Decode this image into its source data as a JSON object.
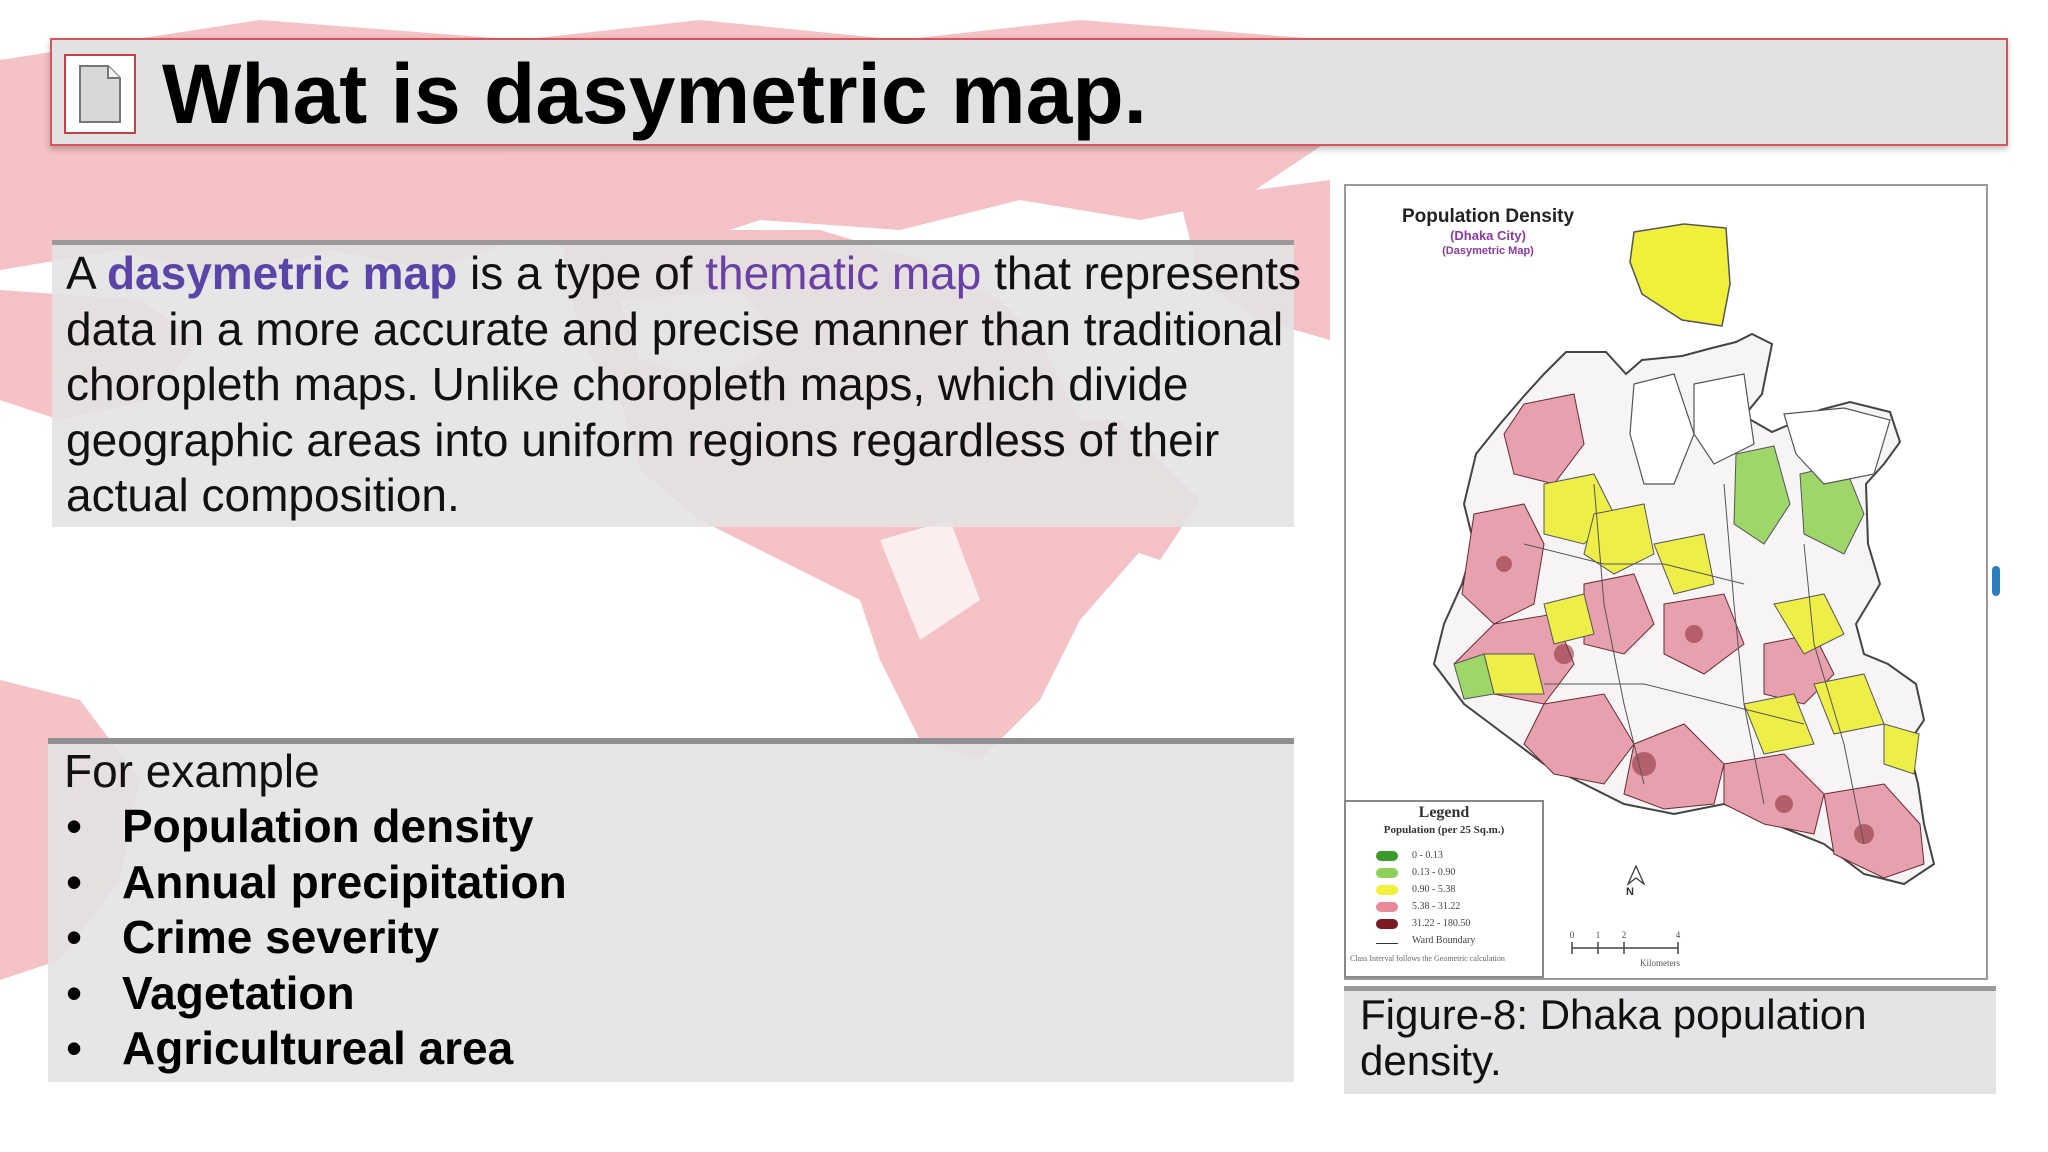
{
  "slide": {
    "title": "What is dasymetric map.",
    "definition": {
      "part1": "A ",
      "term1": "dasymetric map",
      "part2": " is a type of ",
      "term2": "thematic map",
      "part3": " that represents data in a more accurate and precise manner than traditional choropleth maps. Unlike choropleth maps, which divide geographic areas into uniform regions regardless of their actual composition."
    },
    "examples": {
      "heading": "For example",
      "items": [
        "Population density",
        "Annual precipitation",
        "Crime severity",
        "Vagetation",
        "Agricultureal area"
      ]
    },
    "figure": {
      "map_title": "Population Density",
      "map_subtitle": "(Dhaka City)",
      "map_type": "(Dasymetric Map)",
      "legend": {
        "title": "Legend",
        "subtitle": "Population (per 25 Sq.m.)",
        "classes": [
          {
            "label": "0 - 0.13",
            "color": "#3a9a2a"
          },
          {
            "label": "0.13 - 0.90",
            "color": "#8fd05a"
          },
          {
            "label": "0.90 - 5.38",
            "color": "#f2f03a"
          },
          {
            "label": "5.38 - 31.22",
            "color": "#e88a9a"
          },
          {
            "label": "31.22 - 180.50",
            "color": "#7a1a22"
          }
        ],
        "boundary_label": "Ward Boundary",
        "note": "Class Interval follows the Geometric calculation"
      },
      "north_label": "N",
      "scale_ticks": [
        "0",
        "1",
        "2",
        "4"
      ],
      "scale_unit": "Kilometers",
      "caption": "Figure-8: Dhaka population density."
    }
  },
  "colors": {
    "accent_purple": "#5b44a8",
    "title_border": "#d8555b",
    "world_map": "#f2b8bc"
  }
}
